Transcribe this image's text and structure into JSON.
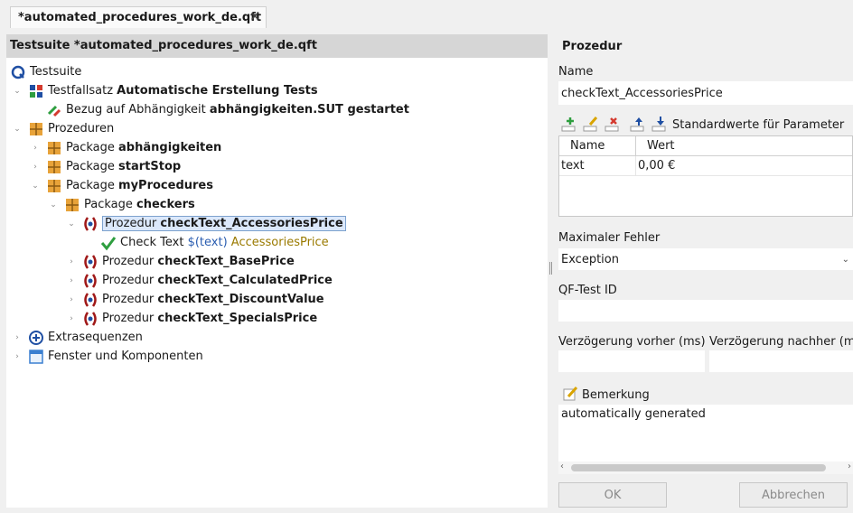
{
  "tab": {
    "title": "*automated_procedures_work_de.qft",
    "close": "✕"
  },
  "tree": {
    "header": "Testsuite *automated_procedures_work_de.qft",
    "nodes": [
      {
        "prefix": "Testsuite",
        "name": ""
      },
      {
        "prefix": "Testfallsatz",
        "name": "Automatische Erstellung Tests"
      },
      {
        "prefix": "Bezug auf Abhängigkeit",
        "name": "abhängigkeiten.SUT gestartet"
      },
      {
        "prefix": "Prozeduren",
        "name": ""
      },
      {
        "prefix": "Package",
        "name": "abhängigkeiten"
      },
      {
        "prefix": "Package",
        "name": "startStop"
      },
      {
        "prefix": "Package",
        "name": "myProcedures"
      },
      {
        "prefix": "Package",
        "name": "checkers"
      },
      {
        "prefix": "Prozedur",
        "name": "checkText_AccessoriesPrice"
      },
      {
        "prefix": "Check Text",
        "var": "$(text)",
        "comp": "AccessoriesPrice"
      },
      {
        "prefix": "Prozedur",
        "name": "checkText_BasePrice"
      },
      {
        "prefix": "Prozedur",
        "name": "checkText_CalculatedPrice"
      },
      {
        "prefix": "Prozedur",
        "name": "checkText_DiscountValue"
      },
      {
        "prefix": "Prozedur",
        "name": "checkText_SpecialsPrice"
      },
      {
        "prefix": "Extrasequenzen",
        "name": ""
      },
      {
        "prefix": "Fenster und Komponenten",
        "name": ""
      }
    ]
  },
  "detail": {
    "heading": "Prozedur",
    "name_label": "Name",
    "name_value": "checkText_AccessoriesPrice",
    "defaults_label": "Standardwerte für Parameter",
    "table": {
      "columns": [
        "Name",
        "Wert"
      ],
      "rows": [
        {
          "name": "text",
          "value": "0,00 €"
        }
      ]
    },
    "max_error_label": "Maximaler Fehler",
    "max_error_value": "Exception",
    "qfid_label": "QF-Test ID",
    "qfid_value": "",
    "delay_before_label": "Verzögerung vorher (ms)",
    "delay_after_label": "Verzögerung nachher (ms)",
    "delay_before_value": "",
    "delay_after_value": "",
    "comment_label": "Bemerkung",
    "comment_value": "automatically generated",
    "ok": "OK",
    "cancel": "Abbrechen"
  },
  "colors": {
    "selection": "#dbe8fb",
    "header": "#d6d6d6",
    "variable": "#2a5db0",
    "component": "#9a7a00"
  }
}
